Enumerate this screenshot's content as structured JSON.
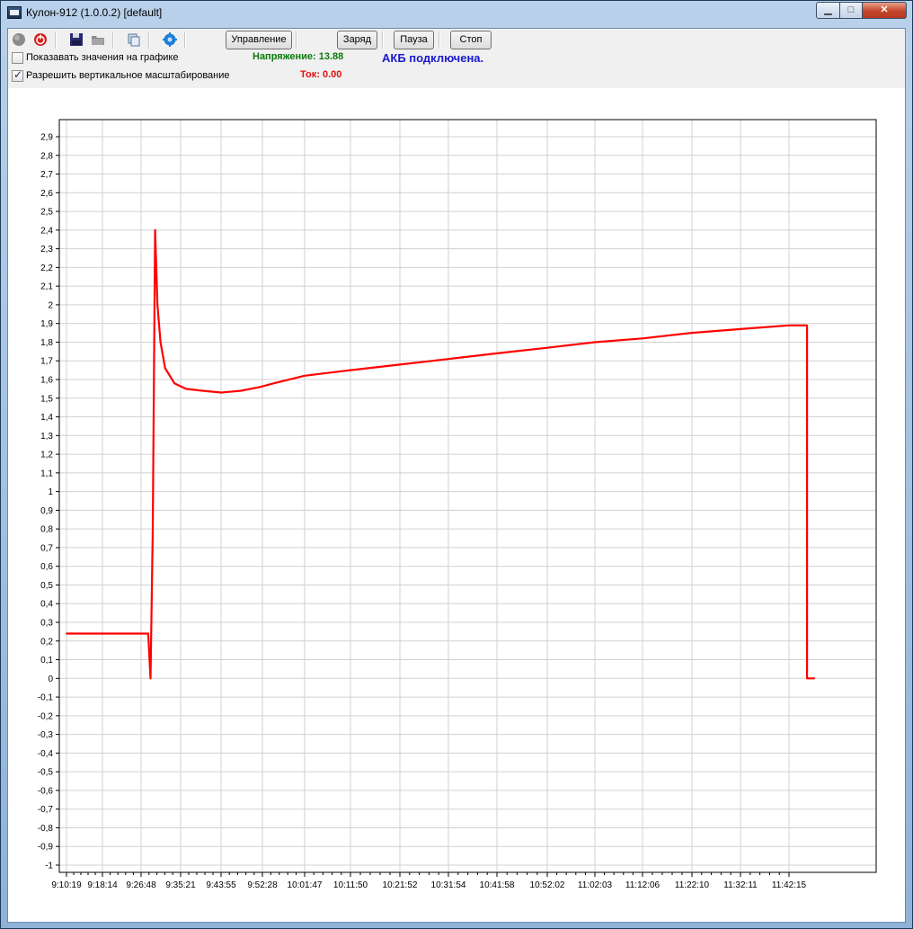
{
  "window": {
    "title": "Кулон-912 (1.0.0.2) [default]",
    "min_glyph": "▁",
    "max_glyph": "□",
    "close_glyph": "✕"
  },
  "toolbar": {
    "control_label": "Управление",
    "charge_label": "Заряд",
    "pause_label": "Пауза",
    "stop_label": "Стоп",
    "icons": [
      "record-icon",
      "power-icon",
      "save-icon",
      "open-icon",
      "copy-icon",
      "settings-icon"
    ]
  },
  "options": {
    "show_values_label": "Показавать значения на графике",
    "show_values_checked": false,
    "vertical_zoom_label": "Разрешить вертикальное масштабирование",
    "vertical_zoom_checked": true
  },
  "status": {
    "voltage": "Напряжение: 13.88",
    "voltage_color": "#0a7a0a",
    "current": "Ток: 0.00",
    "current_color": "#e01010",
    "battery": "АКБ подключена.",
    "battery_color": "#1a1acc"
  },
  "chart_data": {
    "type": "line",
    "title": "",
    "xlabel": "",
    "ylabel": "",
    "ylim": [
      -1,
      3
    ],
    "y_ticks": [
      "2,9",
      "2,8",
      "2,7",
      "2,6",
      "2,5",
      "2,4",
      "2,3",
      "2,2",
      "2,1",
      "2",
      "1,9",
      "1,8",
      "1,7",
      "1,6",
      "1,5",
      "1,4",
      "1,3",
      "1,2",
      "1,1",
      "1",
      "0,9",
      "0,8",
      "0,7",
      "0,6",
      "0,5",
      "0,4",
      "0,3",
      "0,2",
      "0,1",
      "0",
      "-0,1",
      "-0,2",
      "-0,3",
      "-0,4",
      "-0,5",
      "-0,6",
      "-0,7",
      "-0,8",
      "-0,9",
      "-1"
    ],
    "x_ticks": [
      "9:10:19",
      "9:18:14",
      "9:26:48",
      "9:35:21",
      "9:43:55",
      "9:52:28",
      "10:01:47",
      "10:11:50",
      "10:21:52",
      "10:31:54",
      "10:41:58",
      "10:52:02",
      "11:02:03",
      "11:12:06",
      "11:22:10",
      "11:32:11",
      "11:42:15"
    ],
    "grid": true,
    "line_color": "#ff0000",
    "series": [
      {
        "x": [
          "9:10:19",
          "9:26:48",
          "9:28:20",
          "9:28:50",
          "9:29:20",
          "9:29:50",
          "9:30:20",
          "9:31:00",
          "9:32:00",
          "9:34:00",
          "9:36:30",
          "9:40:00",
          "9:44:00",
          "9:48:00",
          "9:52:00",
          "9:55:00",
          "10:01:47",
          "10:11:50",
          "10:21:52",
          "10:31:54",
          "10:41:58",
          "10:52:02",
          "11:02:03",
          "11:12:06",
          "11:22:10",
          "11:32:11",
          "11:42:15",
          "11:46:00",
          "11:46:00",
          "11:47:30"
        ],
        "y": [
          0.24,
          0.24,
          0.24,
          0.0,
          0.8,
          2.4,
          2.0,
          1.8,
          1.66,
          1.58,
          1.55,
          1.54,
          1.53,
          1.54,
          1.56,
          1.58,
          1.62,
          1.65,
          1.68,
          1.71,
          1.74,
          1.77,
          1.8,
          1.82,
          1.85,
          1.87,
          1.89,
          1.89,
          0.0,
          0.0
        ]
      }
    ]
  }
}
